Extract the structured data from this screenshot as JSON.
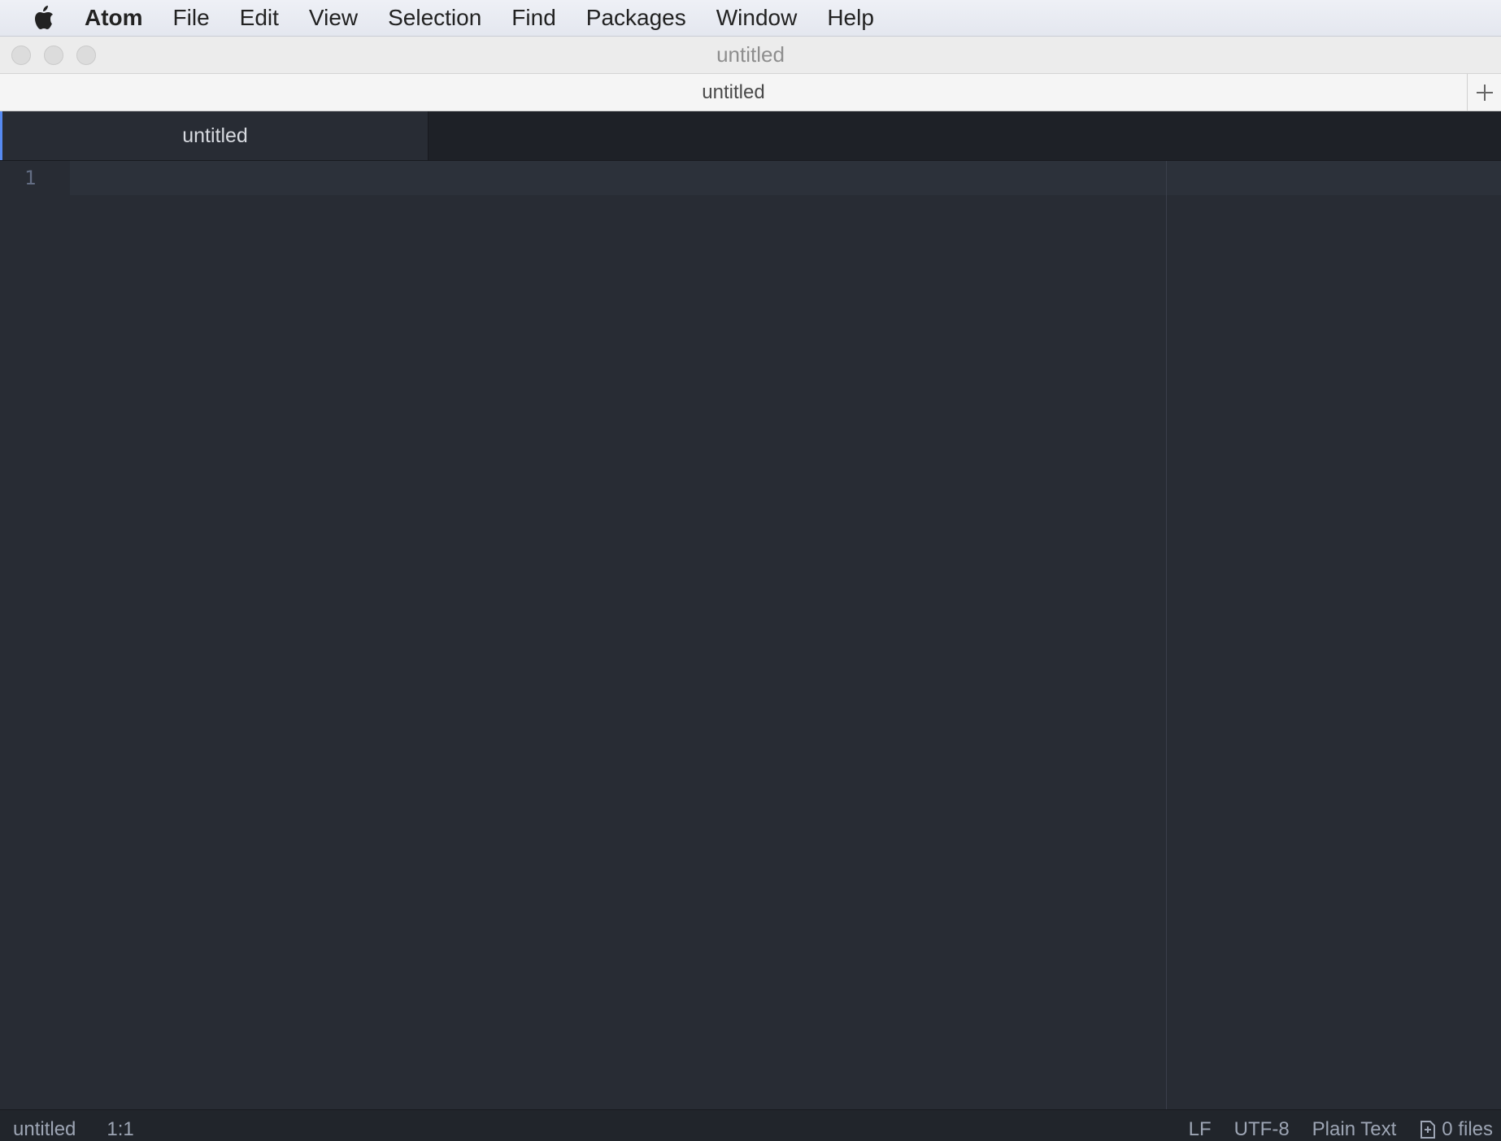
{
  "menubar": {
    "apple_icon": "apple-logo-icon",
    "app_name": "Atom",
    "items": [
      "File",
      "Edit",
      "View",
      "Selection",
      "Find",
      "Packages",
      "Window",
      "Help"
    ]
  },
  "window": {
    "title": "untitled"
  },
  "tabbar_light": {
    "label": "untitled"
  },
  "tabs": [
    {
      "label": "untitled",
      "active": true
    }
  ],
  "editor": {
    "line_numbers": [
      "1"
    ],
    "content": ""
  },
  "statusbar": {
    "file_name": "untitled",
    "cursor_position": "1:1",
    "line_ending": "LF",
    "encoding": "UTF-8",
    "grammar": "Plain Text",
    "files_count": "0 files"
  },
  "colors": {
    "accent": "#568af2",
    "editor_bg": "#282c34",
    "tabbar_bg": "#1e2127"
  }
}
